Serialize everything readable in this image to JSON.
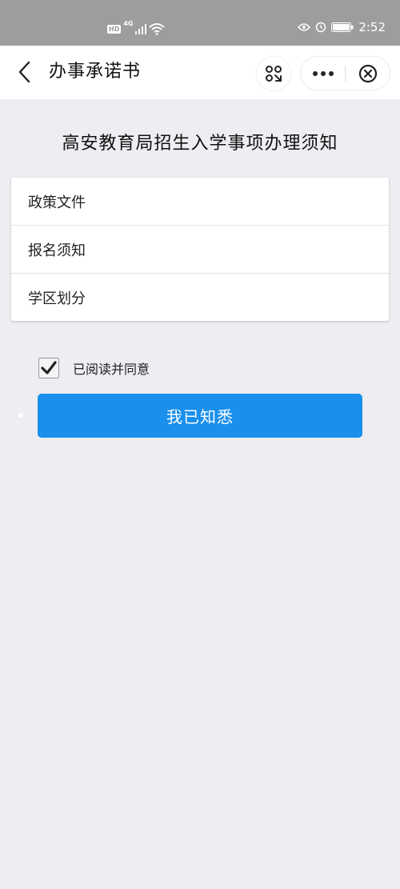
{
  "status_bar": {
    "hd_badge": "HD",
    "network": "4G",
    "clock": "2:52"
  },
  "nav": {
    "title": "办事承诺书",
    "icons": {
      "back": "chevron-left-icon",
      "scan": "scan-icon",
      "more": "more-dots-icon",
      "close": "close-circle-icon"
    }
  },
  "main": {
    "heading": "高安教育局招生入学事项办理须知",
    "items": [
      {
        "label": "政策文件"
      },
      {
        "label": "报名须知"
      },
      {
        "label": "学区划分"
      }
    ],
    "agree": {
      "checked": true,
      "label": "已阅读并同意"
    },
    "confirm_button": "我已知悉"
  },
  "colors": {
    "primary": "#1a8fec",
    "background": "#ededf2",
    "status_bar": "#9d9d9d"
  }
}
